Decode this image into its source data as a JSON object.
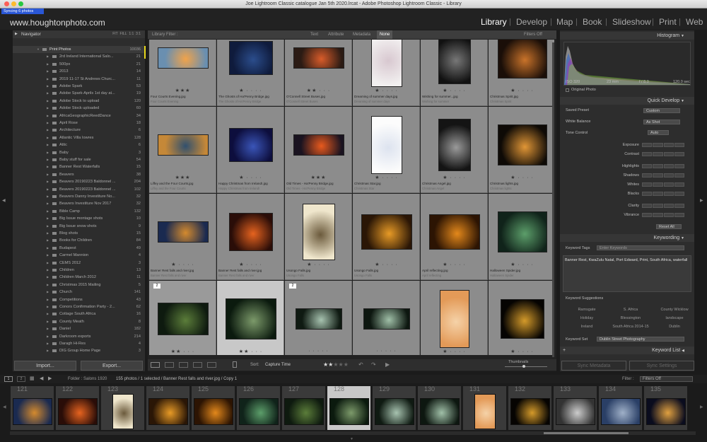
{
  "window": {
    "title": "Joe Lightroom Classic catalogue Jan 5th 2020.lrcat - Adobe Photoshop Lightroom Classic - Library",
    "syncing": "Syncing 6 photos"
  },
  "identity": "www.houghtonphoto.com",
  "modules": [
    "Library",
    "Develop",
    "Map",
    "Book",
    "Slideshow",
    "Print",
    "Web"
  ],
  "navigator": {
    "title": "Navigator",
    "zoom": [
      "FIT",
      "FILL",
      "1:1",
      "3:1"
    ]
  },
  "folders": [
    {
      "name": "Print Photos",
      "count": "10036"
    },
    {
      "name": "2rd Ireland International Salo...",
      "count": "21"
    },
    {
      "name": "500px",
      "count": "21"
    },
    {
      "name": "2013",
      "count": "14"
    },
    {
      "name": "2019 11-17 St Andrews Churc...",
      "count": "11"
    },
    {
      "name": "Adobe Spark",
      "count": "53"
    },
    {
      "name": "Adobe Spark-Aprils 1st day at...",
      "count": "19"
    },
    {
      "name": "Adobe Stock to upload",
      "count": "120"
    },
    {
      "name": "Adobe Stock uploaded",
      "count": "60"
    },
    {
      "name": "AfricaGeographicReedDance",
      "count": "34"
    },
    {
      "name": "April Rose",
      "count": "18"
    },
    {
      "name": "Architecture",
      "count": "6"
    },
    {
      "name": "Atlantic Villa Iowres",
      "count": "128"
    },
    {
      "name": "Attic",
      "count": "6"
    },
    {
      "name": "Baby",
      "count": "3"
    },
    {
      "name": "Baby stuff for sale",
      "count": "54"
    },
    {
      "name": "Banner Rest Waterfalls",
      "count": "15"
    },
    {
      "name": "Beavers",
      "count": "38"
    },
    {
      "name": "Beavers 20190223 Baldonnel ...",
      "count": "204"
    },
    {
      "name": "Beavers 20190223 Baldonnel ...",
      "count": "102"
    },
    {
      "name": "Beavers Danny Investiture No...",
      "count": "32"
    },
    {
      "name": "Beavers Investiture Nov 2017",
      "count": "32"
    },
    {
      "name": "Bible Camp",
      "count": "132"
    },
    {
      "name": "Big Issue montage shots",
      "count": "10"
    },
    {
      "name": "Big Issue snow shots",
      "count": "9"
    },
    {
      "name": "Blog shots",
      "count": "15"
    },
    {
      "name": "Books for Children",
      "count": "84"
    },
    {
      "name": "Budapest",
      "count": "49"
    },
    {
      "name": "Carmel Mannion",
      "count": "4"
    },
    {
      "name": "CEMS 2012",
      "count": "3"
    },
    {
      "name": "Children",
      "count": "13"
    },
    {
      "name": "Children March 2012",
      "count": "11"
    },
    {
      "name": "Christmas 2015 Mailing",
      "count": "5"
    },
    {
      "name": "Church",
      "count": "141"
    },
    {
      "name": "Competitions",
      "count": "43"
    },
    {
      "name": "Conors Confirmation Party - 2...",
      "count": "62"
    },
    {
      "name": "Cottage South Africa",
      "count": "16"
    },
    {
      "name": "County Meath",
      "count": "8"
    },
    {
      "name": "Daniel",
      "count": "182"
    },
    {
      "name": "Darkroom exports",
      "count": "214"
    },
    {
      "name": "Daragh Hi-Res",
      "count": "4"
    },
    {
      "name": "DIG Group Home Page",
      "count": "3"
    }
  ],
  "left_buttons": {
    "import": "Import...",
    "export": "Export..."
  },
  "filter_bar": {
    "label": "Library Filter :",
    "options": [
      "Text",
      "Attribute",
      "Metadata",
      "None"
    ],
    "status": "Filters Off"
  },
  "grid": [
    {
      "name": "Four Courts Evening.jpg",
      "meta": "04... 8.0",
      "sub": "Four Courts Evening",
      "stars": "★★★",
      "colors": [
        "#6a8fb0",
        "#f1a34a"
      ]
    },
    {
      "name": "The Ghosts of Ha'Penny Bridge.jpg",
      "meta": "",
      "sub": "The Ghosts of Ha'Penny Bridge",
      "stars": "★ · · · ·",
      "colors": [
        "#0f1b3c",
        "#2b4d8c"
      ]
    },
    {
      "name": "O'Connell Street Buses.jpg",
      "meta": "1/1...",
      "sub": "O'Connell Street Buses",
      "stars": "★★ · · ·",
      "colors": [
        "#2b1b14",
        "#d95c2a"
      ]
    },
    {
      "name": "Dreaming of summer days.jpg",
      "meta": "",
      "sub": "Dreaming of summer days",
      "stars": "★ · · · ·",
      "colors": [
        "#f2f0f0",
        "#d8c8d0"
      ]
    },
    {
      "name": "Wishing for summer...jpg",
      "meta": "1/40 sec",
      "sub": "Wishing for summer",
      "stars": "★ · · · ·",
      "colors": [
        "#111",
        "#777"
      ]
    },
    {
      "name": "Christmas Spirit.jpg",
      "meta": "",
      "sub": "Christmas Spirit",
      "stars": "★ · · · ·",
      "colors": [
        "#1a0e08",
        "#c9732a"
      ]
    },
    {
      "name": "Liffey and the Four Courts.jpg",
      "meta": "",
      "sub": "Liffey and the Four Courts",
      "stars": "★★★",
      "colors": [
        "#c58838",
        "#31506e"
      ]
    },
    {
      "name": "Happy Christmas from Ireland!.jpg",
      "meta": "",
      "sub": "Happy Christmas from Ireland!",
      "stars": "★ · · · ·",
      "colors": [
        "#0d0e3d",
        "#3a55b8"
      ]
    },
    {
      "name": "Old Times - Ha'Penny Bridge.jpg",
      "meta": "",
      "sub": "Old Times - Ha'Penny Bridge",
      "stars": "★★★",
      "colors": [
        "#1a1320",
        "#e85a1e"
      ]
    },
    {
      "name": "Christmas Star.jpg",
      "meta": "1/80 se... 4.0 5.6",
      "sub": "Christmas Star",
      "stars": "★ · · · ·",
      "colors": [
        "#fcfcfc",
        "#dde3ef"
      ]
    },
    {
      "name": "Christmas Angel.jpg",
      "meta": "Old Times",
      "sub": "Christmas Angel",
      "stars": "★ · · · ·",
      "colors": [
        "#141414",
        "#9a9a9a"
      ]
    },
    {
      "name": "Christmas lights.jpg",
      "meta": "",
      "sub": "Christmas lights",
      "stars": "★ · · · ·",
      "colors": [
        "#0e0a06",
        "#e19636"
      ]
    },
    {
      "name": "Banner Rest falls and river.jpg",
      "meta": "",
      "sub": "Banner Rest falls and river",
      "stars": "★ · · · ·",
      "colors": [
        "#1a2a50",
        "#d48a2e"
      ]
    },
    {
      "name": "Banner Rest falls and river.jpg",
      "meta": "",
      "sub": "Banner Rest falls and river",
      "stars": "★ · · · ·",
      "colors": [
        "#2a0d08",
        "#e6631f"
      ]
    },
    {
      "name": "Usongo Falls.jpg",
      "meta": "",
      "sub": "Usongo Falls",
      "stars": "★ · · · ·",
      "colors": [
        "#efe6cc",
        "#6b5a3c"
      ]
    },
    {
      "name": "Usongo Falls.jpg",
      "meta": "300 se...",
      "sub": "Usongo Falls",
      "stars": "★ · · · ·",
      "colors": [
        "#2a1606",
        "#e79a26"
      ]
    },
    {
      "name": "April reflecting.jpg",
      "meta": "",
      "sub": "April reflecting",
      "stars": "★ · · · ·",
      "colors": [
        "#2c1403",
        "#e3881b"
      ]
    },
    {
      "name": "Halloween Spider.jpg",
      "meta": "1/40... 8.0",
      "sub": "Halloween Spider",
      "stars": "★ · · · ·",
      "colors": [
        "#10231a",
        "#5c9e6a"
      ]
    },
    {
      "name": "Royal Hospital, Kilmainham.jpg",
      "meta": "1/",
      "sub": "Royal Hospital, Kilmainham",
      "stars": "★★ · · ·",
      "colors": [
        "#0e1a0f",
        "#5b7d3a"
      ]
    },
    {
      "name": "Beckett Bridge at Sunset.jpg",
      "meta": "1/",
      "sub": "Beckett Bridge at Sunset",
      "stars": "★★ · · ·",
      "colors": [
        "#0b1a0e",
        "#7c9a6a"
      ]
    },
    {
      "name": "Light Trails on O'Connell Street Bridge.jpg",
      "meta": "",
      "sub": "Light Trails on O'Connell Street Bridge",
      "stars": "· · · · ·",
      "colors": [
        "#0f1a12",
        "#a7c3b0"
      ]
    },
    {
      "name": "running waters (...ppy 2018-10-10).jpg",
      "meta": "",
      "sub": "Running waters",
      "stars": "· · · · ·",
      "colors": [
        "#0d1710",
        "#a0c0a8"
      ]
    },
    {
      "name": "Running waters.jpg",
      "meta": "",
      "sub": "Running waters",
      "stars": "★ · · · ·",
      "colors": [
        "#e39a58",
        "#f5d2a8"
      ]
    },
    {
      "name": "Springtime!.jpg",
      "meta": "1/520 se...",
      "sub": "Springtime!",
      "stars": "★ · · · ·",
      "colors": [
        "#060402",
        "#d49a2a"
      ]
    }
  ],
  "toolbar": {
    "sort_label": "Sort:",
    "sort_value": "Capture Time",
    "thumbs_label": "Thumbnails"
  },
  "histogram": {
    "title": "Histogram",
    "iso": "ISO 320",
    "focal": "23 mm",
    "fstop": "f / 8.0",
    "shutter": "120.0 sec",
    "original": "Original Photo"
  },
  "quick_develop": {
    "title": "Quick Develop",
    "saved_preset_label": "Saved Preset",
    "saved_preset": "Custom",
    "white_balance_label": "White Balance",
    "white_balance": "As Shot",
    "tone_control_label": "Tone Control",
    "auto": "Auto",
    "sliders": [
      "Exposure",
      "Contrast",
      "Highlights",
      "Shadows",
      "Whites",
      "Blacks",
      "Clarity",
      "Vibrance"
    ],
    "reset": "Reset All"
  },
  "keywording": {
    "title": "Keywording",
    "tags_label": "Keyword Tags",
    "tags_placeholder": "Enter Keywords",
    "keywords_text": "Banner Rest, KwaZulu Natal, Port Edward, Print, South Africa, waterfall",
    "suggestions_label": "Keyword Suggestions",
    "suggestions": [
      "Ramsgate",
      "S. Africa",
      "County Wicklow",
      "Holiday",
      "Blessington",
      "landscape",
      "Ireland",
      "South Africa 2014-15",
      "Dublin"
    ],
    "set_label": "Keyword Set",
    "set_value": "Dublin Street Photography"
  },
  "keyword_list": {
    "title": "Keyword List"
  },
  "sync": {
    "metadata": "Sync Metadata",
    "settings": "Sync Settings"
  },
  "filmstrip_header": {
    "pages": [
      "1",
      "2"
    ],
    "folder": "Folder : Salons 1920",
    "info": "155 photos / 1 selected / Banner Rest falls and river.jpg / Copy 1",
    "filter_label": "Filter :",
    "filter_value": "Filters Off"
  },
  "filmstrip": [
    {
      "num": "121",
      "colors": [
        "#1a2a50",
        "#d48a2e"
      ]
    },
    {
      "num": "122",
      "colors": [
        "#2a0d08",
        "#e6631f"
      ]
    },
    {
      "num": "123",
      "colors": [
        "#efe6cc",
        "#6b5a3c"
      ]
    },
    {
      "num": "124",
      "colors": [
        "#2a1606",
        "#e79a26"
      ]
    },
    {
      "num": "125",
      "colors": [
        "#2c1403",
        "#e3881b"
      ]
    },
    {
      "num": "126",
      "colors": [
        "#10231a",
        "#5c9e6a"
      ]
    },
    {
      "num": "127",
      "colors": [
        "#0e1a0f",
        "#5b7d3a"
      ]
    },
    {
      "num": "128",
      "colors": [
        "#0b1a0e",
        "#7c9a6a"
      ]
    },
    {
      "num": "129",
      "colors": [
        "#0f1a12",
        "#a7c3b0"
      ]
    },
    {
      "num": "130",
      "colors": [
        "#0d1710",
        "#a0c0a8"
      ]
    },
    {
      "num": "131",
      "colors": [
        "#e39a58",
        "#f5d2a8"
      ]
    },
    {
      "num": "132",
      "colors": [
        "#060402",
        "#d49a2a"
      ]
    },
    {
      "num": "133",
      "colors": [
        "#333",
        "#ccc"
      ]
    },
    {
      "num": "134",
      "colors": [
        "#2a3f66",
        "#9fb0c8"
      ]
    },
    {
      "num": "135",
      "colors": [
        "#0a0c1e",
        "#e0a040"
      ]
    }
  ]
}
